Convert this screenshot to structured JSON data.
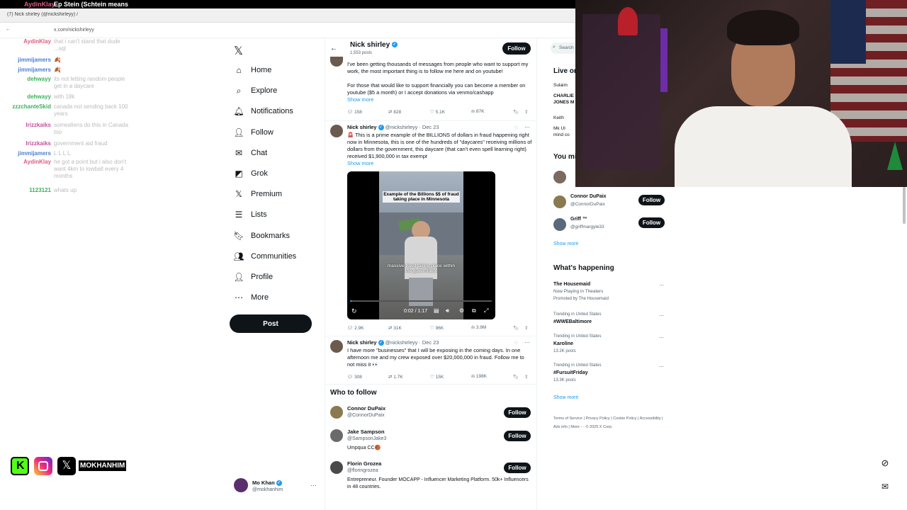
{
  "stream": {
    "top_user": "AydinKlay",
    "top_msg": "Ep Stein (Schtein means",
    "tab_title": "(7) Nick shirley (@nickshirleyy) / X",
    "addr": "x.com/nickshirleyy"
  },
  "chat": [
    {
      "user": "AydinKlay",
      "msg": "that i can't stand that dude ...sql",
      "color": "#e05a80"
    },
    {
      "user": "jimmijamers",
      "msg": "🍂",
      "color": "#4a7fd6"
    },
    {
      "user": "jimmijamers",
      "msg": "🍂",
      "color": "#4a7fd6"
    },
    {
      "user": "dehwayy",
      "msg": "its not letting random people get in a daycare",
      "color": "#3bb15c"
    },
    {
      "user": "dehwayy",
      "msg": "with 18k",
      "color": "#3bb15c"
    },
    {
      "user": "zzzchanteSkid",
      "msg": "canada not sending back 100 years",
      "color": "#3bb15c"
    },
    {
      "user": "Irizzkaiks",
      "msg": "somealiens do this in Canada too",
      "color": "#c44f9d"
    },
    {
      "user": "Irizzkaiks",
      "msg": "government aid fraud",
      "color": "#c44f9d"
    },
    {
      "user": "jimmijamers",
      "msg": "L L L L",
      "color": "#4a7fd6"
    },
    {
      "user": "AydinKlay",
      "msg": "he got a point but i also don't want 4km to lowball every 4 months",
      "color": "#e05a80"
    },
    {
      "user": "1123121",
      "msg": "whats up",
      "color": "#3bb15c"
    }
  ],
  "socials": {
    "handle": "MOKHANHIM"
  },
  "nav": {
    "items": [
      {
        "label": "Home",
        "icon": "home-icon",
        "glyph": "⌂"
      },
      {
        "label": "Explore",
        "icon": "search-icon",
        "glyph": "⌕"
      },
      {
        "label": "Notifications",
        "icon": "bell-icon",
        "glyph": "🔔︎"
      },
      {
        "label": "Follow",
        "icon": "follow-icon",
        "glyph": "👤︎"
      },
      {
        "label": "Chat",
        "icon": "chat-icon",
        "glyph": "✉"
      },
      {
        "label": "Grok",
        "icon": "grok-icon",
        "glyph": "◩"
      },
      {
        "label": "Premium",
        "icon": "x-premium-icon",
        "glyph": "𝕏"
      },
      {
        "label": "Lists",
        "icon": "lists-icon",
        "glyph": "☰"
      },
      {
        "label": "Bookmarks",
        "icon": "bookmark-icon",
        "glyph": "🔖︎"
      },
      {
        "label": "Communities",
        "icon": "communities-icon",
        "glyph": "👥︎"
      },
      {
        "label": "Profile",
        "icon": "profile-icon",
        "glyph": "👤︎"
      },
      {
        "label": "More",
        "icon": "more-icon",
        "glyph": "⋯"
      }
    ],
    "post_label": "Post",
    "account_name": "Mo Khan",
    "account_handle": "@mokhanhim"
  },
  "profile_header": {
    "name": "Nick shirley",
    "posts": "1,553 posts",
    "follow_label": "Follow"
  },
  "tweets": [
    {
      "text": "I've been getting thousands of messages from people who want to support my work, the most important thing is to follow me here and on youtube!",
      "text2": "For those that would like to support financially you can become a member on youtube ($5 a month) or I accept donations via venmo/cashapp",
      "show_more": "Show more",
      "replies": "158",
      "reposts": "828",
      "likes": "5.1K",
      "views": "87K"
    },
    {
      "name": "Nick shirley",
      "handle": "@nickshirleyy",
      "date": "Dec 23",
      "text": "🚨 This is a prime example of the BILLIONS of dollars in fraud happening right now in Minnesota, this is one of the hundreds of \"daycares\" receiving millions of dollars from the government, this daycare (that can't even spell learning right) received $1,900,000 in tax exempt",
      "show_more": "Show more",
      "video_caption_top": "Example of the Billions $$ of fraud taking place in Minnesota",
      "video_caption_bottom": "massive fraud taking place within the government",
      "video_time": "0:02 / 1:17",
      "replies": "2.9K",
      "reposts": "31K",
      "likes": "96K",
      "views": "3.9M"
    },
    {
      "name": "Nick shirley",
      "handle": "@nickshirleyy",
      "date": "Dec 23",
      "text": "I have more \"businesses\" that I will be exposing in the coming days. In one afternoon me and my crew exposed over $20,000,000 in fraud. Follow me to not miss it 👀",
      "replies": "308",
      "reposts": "1.7K",
      "likes": "15K",
      "views": "198K"
    }
  ],
  "who_to_follow": {
    "title": "Who to follow",
    "items": [
      {
        "name": "Connor DuPaix",
        "handle": "@ConnorDuPaix",
        "bio": ""
      },
      {
        "name": "Jake Sampson",
        "handle": "@SampsonJake3",
        "bio": "Umpqua CC🏀"
      },
      {
        "name": "Florin Grozea",
        "handle": "@floringrozea",
        "bio": "Entrepreneur. Founder MOCAPP - Influencer Marketing Platform. 50k+ Influencers in 48 countries."
      }
    ],
    "follow_label": "Follow"
  },
  "right": {
    "search_placeholder": "Search",
    "live_title": "Live on X",
    "live1_user": "Sulaim",
    "live1_text": "CHARLIE JONES M",
    "live2_user": "Keith",
    "live2_text": "Mk UI mind co",
    "you_might_like": "You might like",
    "suggestions": [
      {
        "name": "Connor DuPaix",
        "handle": "@ConnorDuPaix"
      },
      {
        "name": "Griff ™",
        "handle": "@griffmargyle33"
      }
    ],
    "show_more": "Show more",
    "happening_title": "What's happening",
    "trends": [
      {
        "top": "The Housemaid",
        "mid": "Now Playing in Theaters",
        "sub": "Promoted by The Housemaid"
      },
      {
        "top": "Trending in United States",
        "mid": "#WWEBaltimore",
        "sub": ""
      },
      {
        "top": "Trending in United States",
        "mid": "Karoline",
        "sub": "13.2K posts"
      },
      {
        "top": "Trending in United States",
        "mid": "#FursuitFriday",
        "sub": "13.3K posts"
      }
    ],
    "footer": "Terms of Service | Privacy Policy | Cookie Policy | Accessibility | Ads info | More ··· © 2025 X Corp."
  }
}
